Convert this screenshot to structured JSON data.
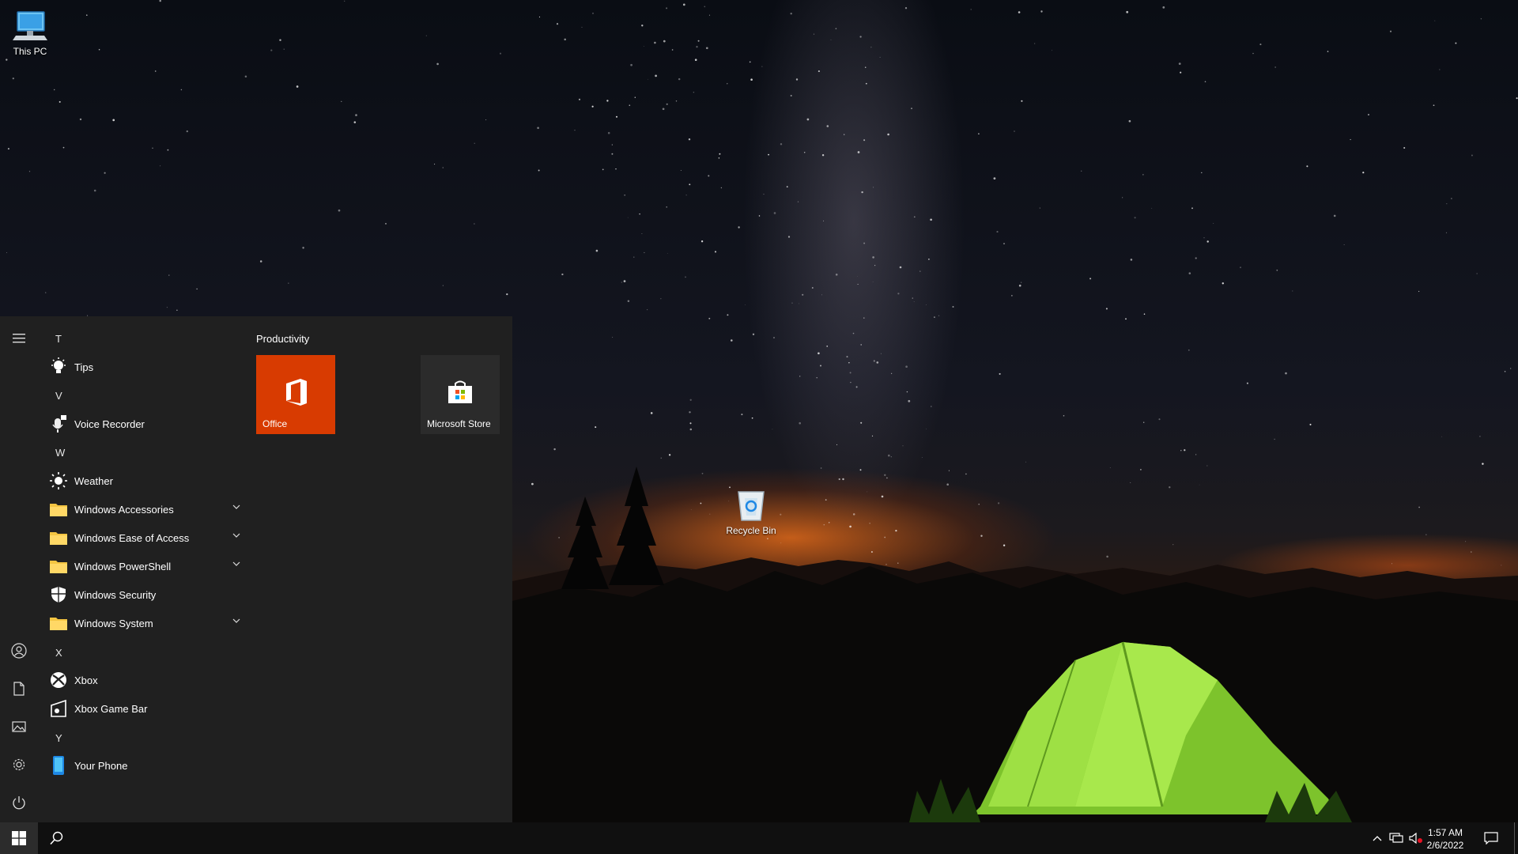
{
  "desktop": {
    "icons": [
      {
        "label": "This PC",
        "icon": "this-pc-icon"
      },
      {
        "label": "Recycle Bin",
        "icon": "recycle-bin-icon"
      }
    ]
  },
  "start_menu": {
    "rail": {
      "menu": "hamburger-menu-icon",
      "user": "user-account-icon",
      "documents": "documents-icon",
      "pictures": "pictures-icon",
      "settings": "settings-gear-icon",
      "power": "power-icon"
    },
    "app_list": {
      "groups": [
        {
          "letter": "T",
          "apps": [
            {
              "label": "Tips",
              "icon": "tips-lightbulb-icon"
            }
          ]
        },
        {
          "letter": "V",
          "apps": [
            {
              "label": "Voice Recorder",
              "icon": "microphone-icon"
            }
          ]
        },
        {
          "letter": "W",
          "apps": [
            {
              "label": "Weather",
              "icon": "weather-sun-icon"
            },
            {
              "label": "Windows Accessories",
              "icon": "folder-icon",
              "expandable": true
            },
            {
              "label": "Windows Ease of Access",
              "icon": "folder-icon",
              "expandable": true
            },
            {
              "label": "Windows PowerShell",
              "icon": "folder-icon",
              "expandable": true
            },
            {
              "label": "Windows Security",
              "icon": "shield-icon"
            },
            {
              "label": "Windows System",
              "icon": "folder-icon",
              "expandable": true
            }
          ]
        },
        {
          "letter": "X",
          "apps": [
            {
              "label": "Xbox",
              "icon": "xbox-icon"
            },
            {
              "label": "Xbox Game Bar",
              "icon": "game-bar-icon"
            }
          ]
        },
        {
          "letter": "Y",
          "apps": [
            {
              "label": "Your Phone",
              "icon": "phone-icon"
            }
          ]
        }
      ]
    },
    "tiles": {
      "group_title": "Productivity",
      "items": [
        {
          "label": "Office",
          "icon": "office-logo-icon",
          "color": "#d83b01"
        },
        {
          "label": "Microsoft Store",
          "icon": "store-bag-icon",
          "color": "#2b2b2b"
        }
      ]
    }
  },
  "taskbar": {
    "start_icon": "windows-logo-icon",
    "search_icon": "search-icon",
    "tray_icons": [
      "chevron-up-icon",
      "network-icon",
      "volume-muted-icon"
    ],
    "time": "1:57 AM",
    "date": "2/6/2022",
    "notification_icon": "action-center-icon"
  },
  "colors": {
    "start_bg": "#202020",
    "taskbar_bg": "#101010",
    "office_tile": "#d83b01",
    "store_tile": "#2b2b2b",
    "tent_green": "#8fd63a"
  }
}
